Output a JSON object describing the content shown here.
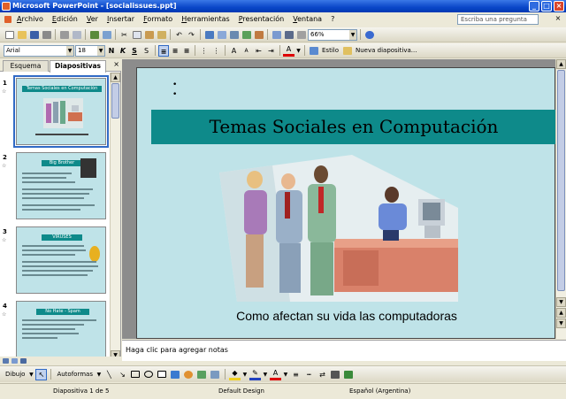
{
  "window": {
    "title": "Microsoft PowerPoint - [socialissues.ppt]"
  },
  "menu": [
    "Archivo",
    "Edición",
    "Ver",
    "Insertar",
    "Formato",
    "Herramientas",
    "Presentación",
    "Ventana",
    "?"
  ],
  "ask_placeholder": "Escriba una pregunta",
  "standard_toolbar": {
    "zoom": "66%"
  },
  "format_toolbar": {
    "font": "Arial",
    "size": "18",
    "bold": "N",
    "italic": "K",
    "underline": "S",
    "design_label": "Estilo",
    "new_slide_label": "Nueva diapositiva..."
  },
  "panel": {
    "tabs": [
      "Esquema",
      "Diapositivas"
    ],
    "active_tab": "Diapositivas",
    "close": "×",
    "thumbnails": [
      {
        "number": "1",
        "title": "Temas Sociales en Computación",
        "selected": true
      },
      {
        "number": "2",
        "title": "Big Brother"
      },
      {
        "number": "3",
        "title": "VIRUSES"
      },
      {
        "number": "4",
        "title": "No Hate - Spam"
      }
    ]
  },
  "slide": {
    "title": "Temas Sociales en Computación",
    "subtitle": "Como afectan su vida las computadoras",
    "bullets": [
      "•",
      "•"
    ]
  },
  "notes_placeholder": "Haga clic para agregar notas",
  "drawing_toolbar": {
    "draw_label": "Dibujo",
    "autoshapes_label": "Autoformas"
  },
  "status": {
    "slide_position": "Diapositiva 1 de 5",
    "design": "Default Design",
    "language": "Español (Argentina)"
  },
  "colors": {
    "title_bar": "#0a46c8",
    "slide_background": "#bfe3e8",
    "title_banner": "#0e8a8a"
  }
}
